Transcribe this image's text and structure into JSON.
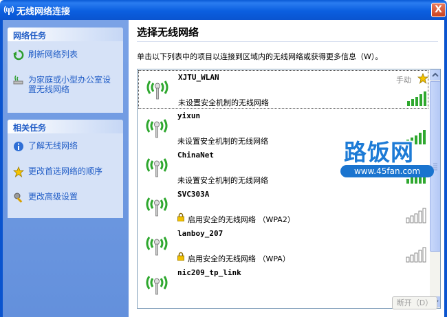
{
  "window": {
    "title": "无线网络连接",
    "close_label": "X"
  },
  "sidebar": {
    "network_tasks": {
      "header": "网络任务",
      "items": [
        {
          "label": "刷新网络列表",
          "icon": "refresh-icon"
        },
        {
          "label_line1": "为家庭或小型办公室设",
          "label_line2": "置无线网络",
          "icon": "network-setup-icon"
        }
      ]
    },
    "related_tasks": {
      "header": "相关任务",
      "items": [
        {
          "label": "了解无线网络",
          "icon": "info-icon"
        },
        {
          "label": "更改首选网络的顺序",
          "icon": "star-icon"
        },
        {
          "label": "更改高级设置",
          "icon": "settings-icon"
        }
      ]
    }
  },
  "main": {
    "title": "选择无线网络",
    "instruction": "单击以下列表中的项目以连接到区域内的无线网络或获得更多信息（W）。",
    "disconnect_label": "断开（D）"
  },
  "networks": [
    {
      "name": "XJTU_WLAN",
      "status": "未设置安全机制的无线网络",
      "secured": false,
      "manual_label": "手动",
      "preferred": true,
      "signal_bars": 5,
      "selected": true
    },
    {
      "name": "yixun",
      "status": "未设置安全机制的无线网络",
      "secured": false,
      "signal_bars": 5
    },
    {
      "name": "ChinaNet",
      "status": "未设置安全机制的无线网络",
      "secured": false,
      "signal_bars": 5
    },
    {
      "name": "SVC303A",
      "status": "启用安全的无线网络 （WPA2）",
      "secured": true,
      "signal_bars": 0
    },
    {
      "name": "lanboy_207",
      "status": "启用安全的无线网络 （WPA）",
      "secured": true,
      "signal_bars": 0
    },
    {
      "name": "nic209_tp_link",
      "status": "",
      "secured": false,
      "signal_bars": 0
    }
  ],
  "watermark": {
    "brand": "路饭网",
    "url": "www.45fan.com"
  },
  "colors": {
    "title_bar": "#0a54cf",
    "sidebar": "#6d97de",
    "task_link": "#215dc6",
    "signal_green": "#2fa82f"
  }
}
